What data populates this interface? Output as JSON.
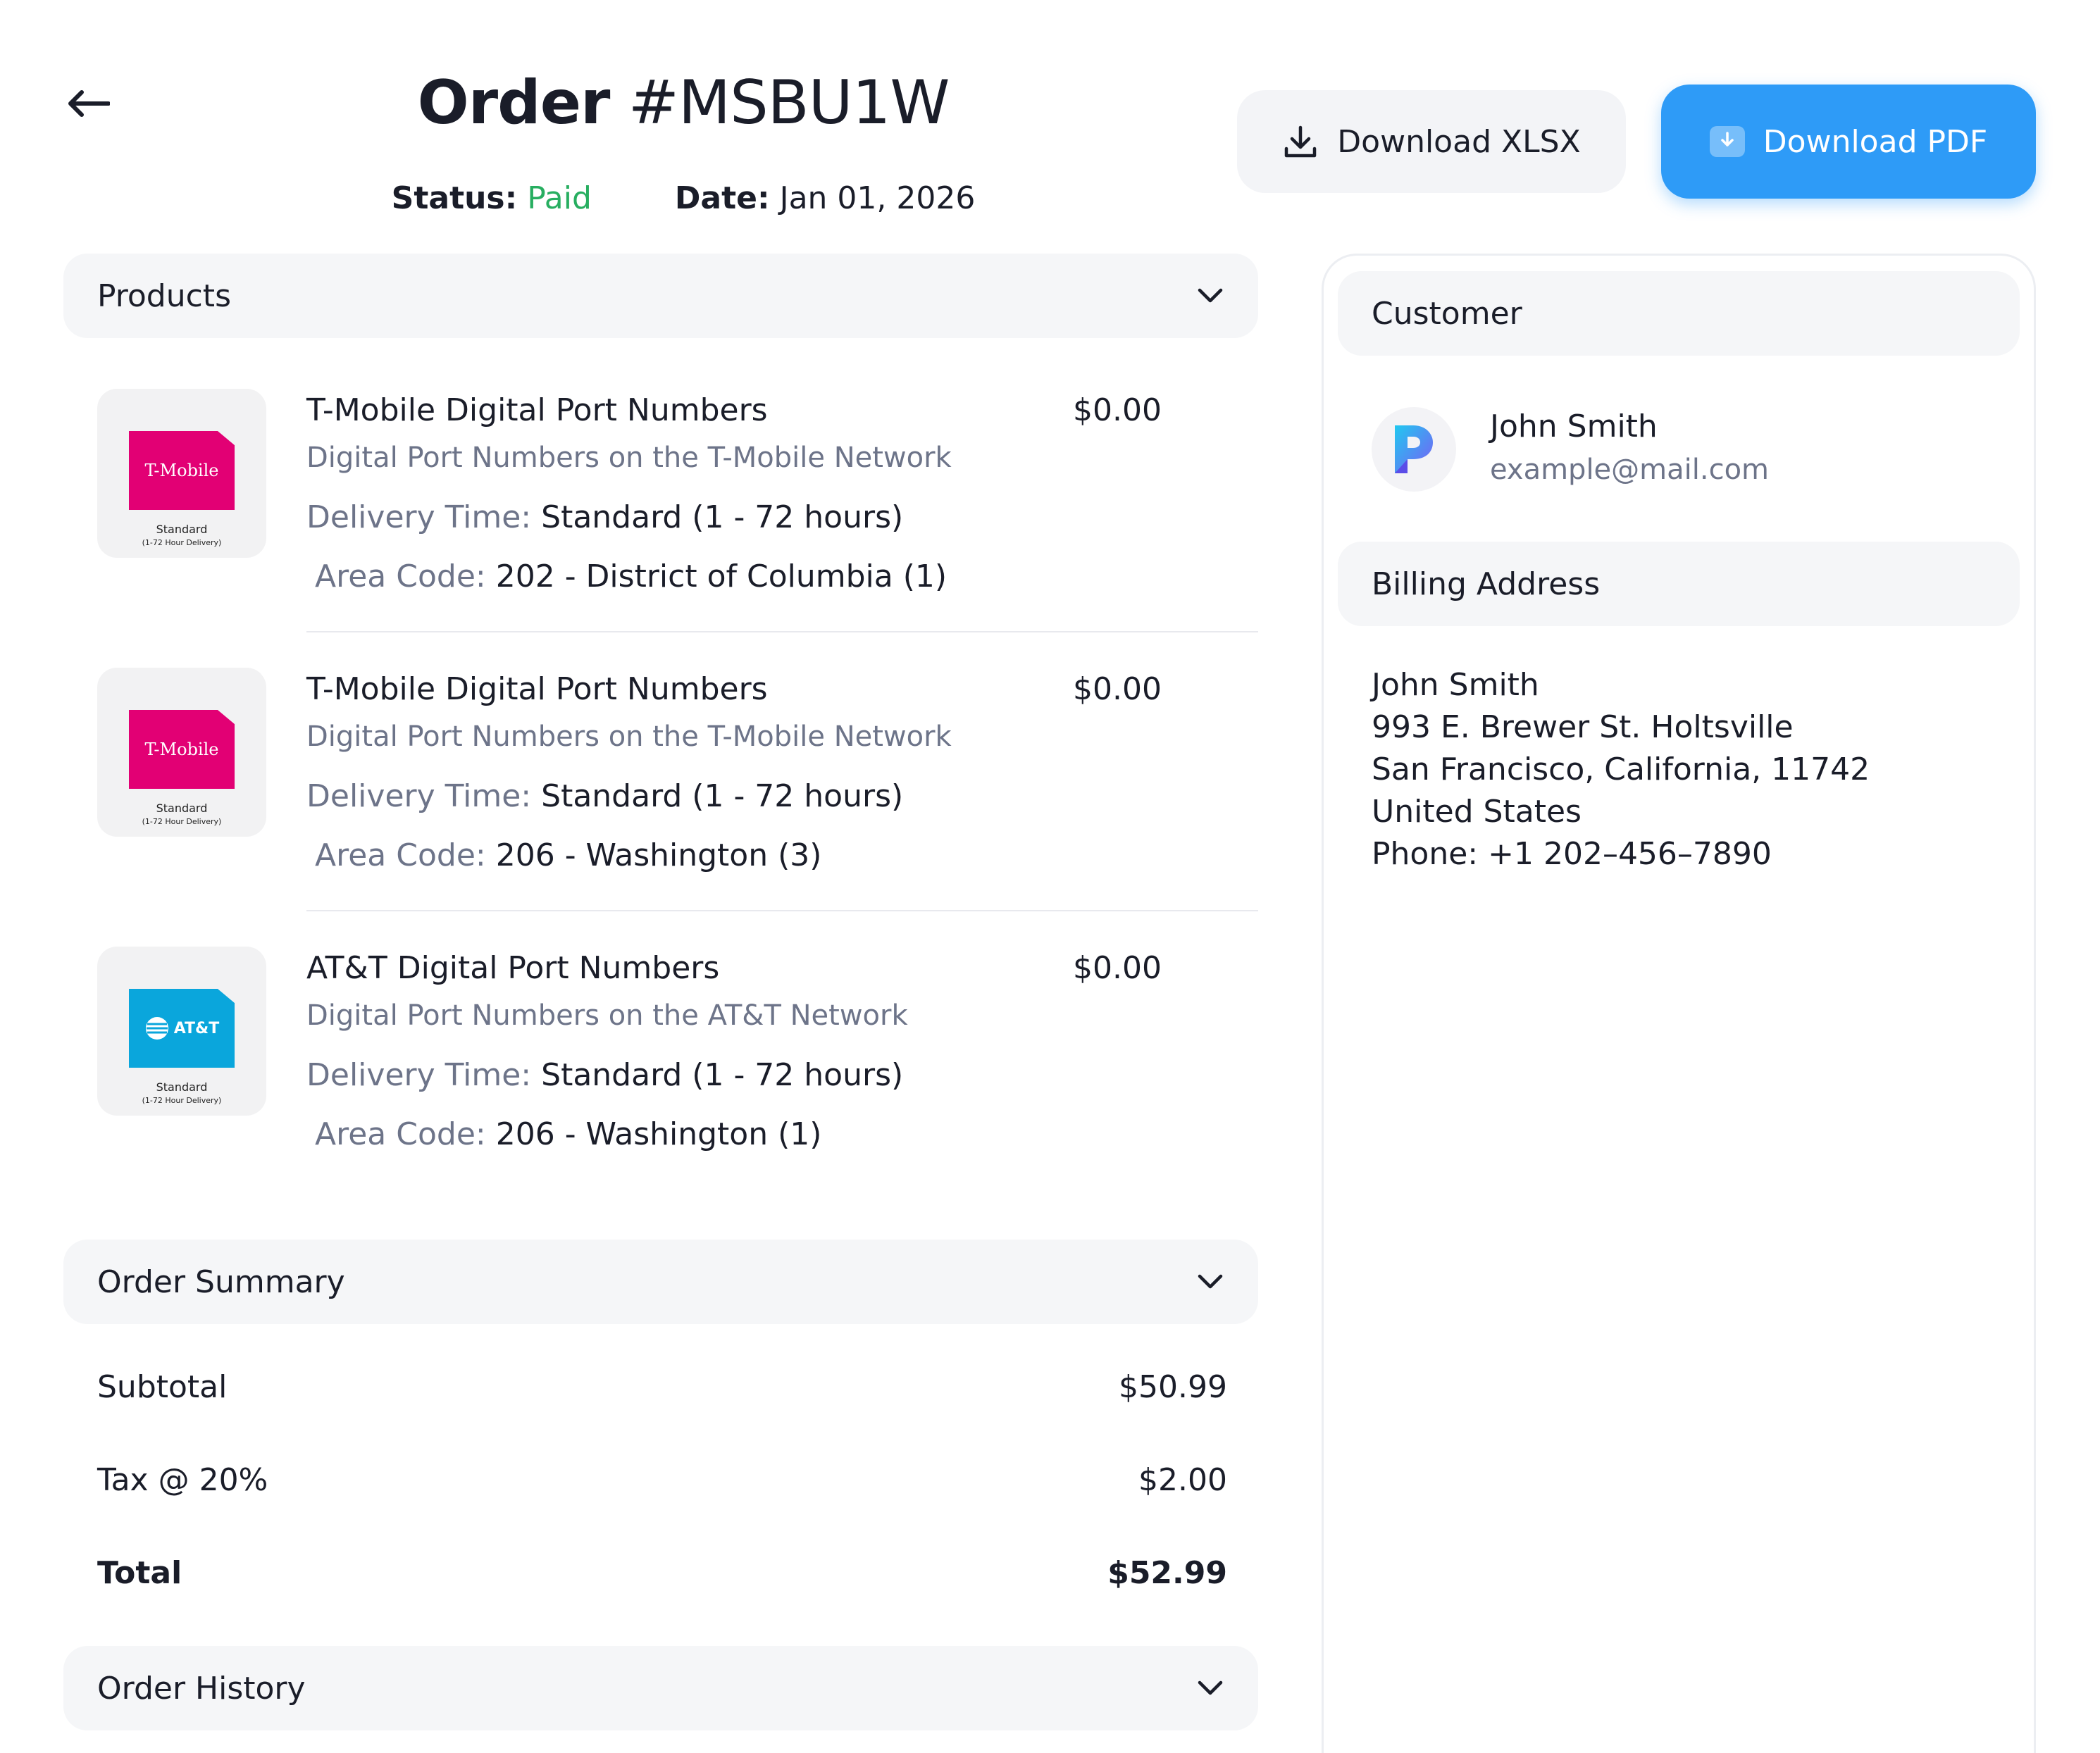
{
  "header": {
    "title_prefix": "Order",
    "order_id": "#MSBU1W",
    "status_label": "Status:",
    "status_value": "Paid",
    "date_label": "Date:",
    "date_value": "Jan 01, 2026",
    "download_xlsx_label": "Download XLSX",
    "download_pdf_label": "Download PDF"
  },
  "products_section": {
    "title": "Products",
    "items": [
      {
        "thumb_brand": "T-Mobile",
        "thumb_caption": "Standard",
        "thumb_subcaption": "(1-72 Hour Delivery)",
        "title": "T-Mobile Digital Port Numbers",
        "price": "$0.00",
        "description": "Digital Port Numbers on the T-Mobile Network",
        "delivery_label": "Delivery Time:",
        "delivery_value": "Standard (1 - 72 hours)",
        "area_label": "Area Code:",
        "area_value": "202 - District of Columbia (1)"
      },
      {
        "thumb_brand": "T-Mobile",
        "thumb_caption": "Standard",
        "thumb_subcaption": "(1-72 Hour Delivery)",
        "title": "T-Mobile Digital Port Numbers",
        "price": "$0.00",
        "description": "Digital Port Numbers on the T-Mobile Network",
        "delivery_label": "Delivery Time:",
        "delivery_value": "Standard (1 - 72 hours)",
        "area_label": "Area Code:",
        "area_value": "206 - Washington (3)"
      },
      {
        "thumb_brand": "AT&T",
        "thumb_caption": "Standard",
        "thumb_subcaption": "(1-72 Hour Delivery)",
        "title": "AT&T Digital Port Numbers",
        "price": "$0.00",
        "description": "Digital Port Numbers on the AT&T Network",
        "delivery_label": "Delivery Time:",
        "delivery_value": "Standard (1 - 72 hours)",
        "area_label": "Area Code:",
        "area_value": "206 - Washington (1)"
      }
    ]
  },
  "order_summary": {
    "title": "Order Summary",
    "rows": [
      {
        "label": "Subtotal",
        "value": "$50.99"
      },
      {
        "label": "Tax @ 20%",
        "value": "$2.00"
      },
      {
        "label": "Total",
        "value": "$52.99"
      }
    ]
  },
  "order_history": {
    "title": "Order History"
  },
  "customer": {
    "title": "Customer",
    "name": "John Smith",
    "email": "example@mail.com"
  },
  "billing": {
    "title": "Billing Address",
    "lines": [
      "John Smith",
      "993 E. Brewer St. Holtsville",
      "San Francisco, California, 11742",
      "United States",
      "Phone: +1 202–456–7890"
    ]
  },
  "colors": {
    "accent": "#2e9bf7",
    "status_paid": "#27ae60",
    "tmobile_magenta": "#e20074",
    "att_blue": "#0aa6dc",
    "muted_text": "#6d7489"
  },
  "icons": {
    "back": "arrow-left-icon",
    "download": "download-icon",
    "chevron": "chevron-down-icon",
    "avatar": "p-logo-icon"
  }
}
